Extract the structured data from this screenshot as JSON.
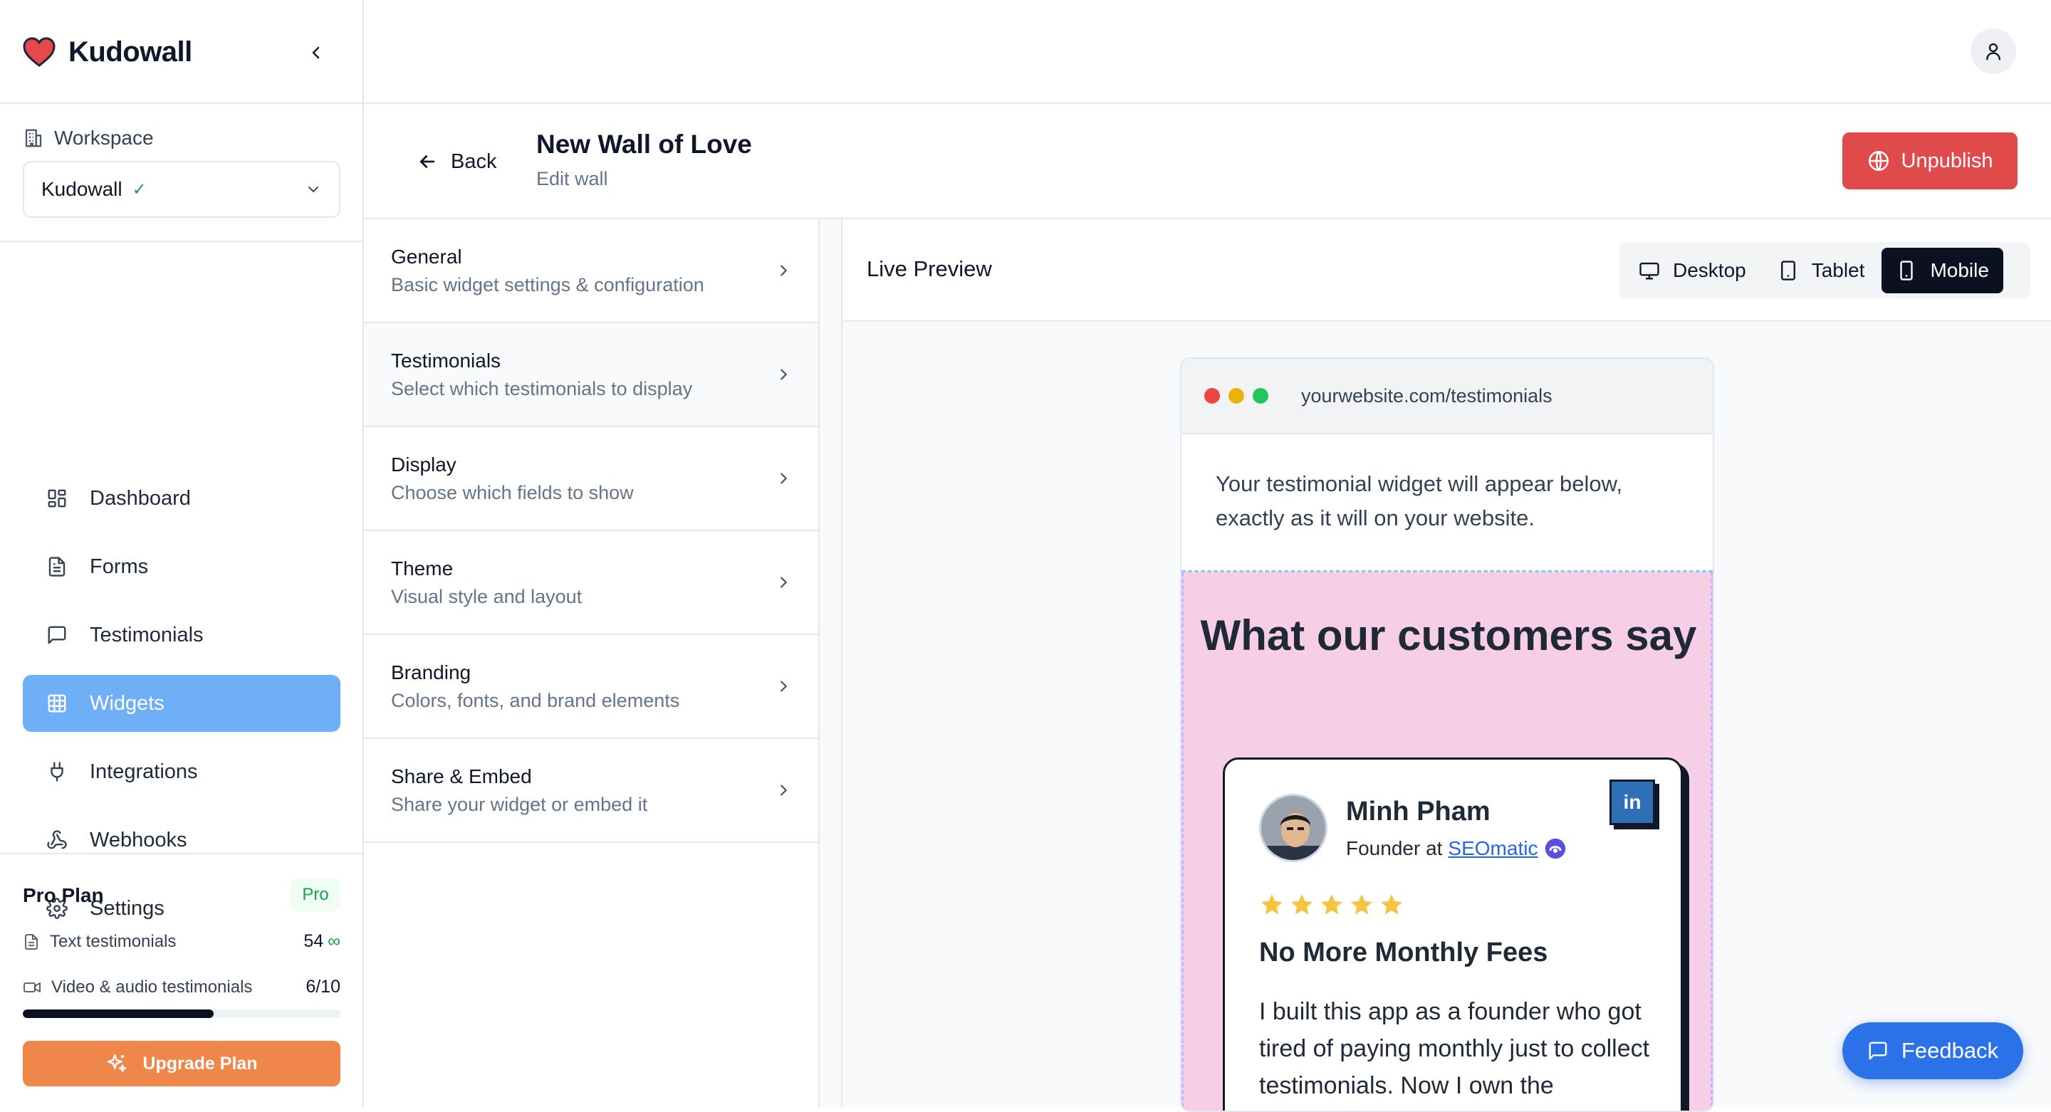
{
  "app": {
    "name": "Kudowall"
  },
  "workspace": {
    "label": "Workspace",
    "selected": "Kudowall",
    "verified_mark": "✓"
  },
  "nav": {
    "items": [
      {
        "label": "Dashboard",
        "icon": "layout-grid-icon"
      },
      {
        "label": "Forms",
        "icon": "file-text-icon"
      },
      {
        "label": "Testimonials",
        "icon": "message-square-icon"
      },
      {
        "label": "Widgets",
        "icon": "grid-table-icon",
        "active": true
      },
      {
        "label": "Integrations",
        "icon": "plug-icon"
      },
      {
        "label": "Webhooks",
        "icon": "webhook-icon"
      },
      {
        "label": "Settings",
        "icon": "gear-icon"
      }
    ]
  },
  "plan": {
    "title": "Pro Plan",
    "badge": "Pro",
    "text_label": "Text testimonials",
    "text_value": "54",
    "text_infinity": "∞",
    "video_label": "Video & audio testimonials",
    "video_value": "6/10",
    "video_progress": 0.6,
    "upgrade_label": "Upgrade Plan"
  },
  "header": {
    "back_label": "Back",
    "title": "New Wall of Love",
    "subtitle": "Edit wall",
    "unpublish_label": "Unpublish"
  },
  "settings": {
    "items": [
      {
        "title": "General",
        "desc": "Basic widget settings & configuration"
      },
      {
        "title": "Testimonials",
        "desc": "Select which testimonials to display"
      },
      {
        "title": "Display",
        "desc": "Choose which fields to show"
      },
      {
        "title": "Theme",
        "desc": "Visual style and layout"
      },
      {
        "title": "Branding",
        "desc": "Colors, fonts, and brand elements"
      },
      {
        "title": "Share & Embed",
        "desc": "Share your widget or embed it"
      }
    ]
  },
  "preview": {
    "title": "Live Preview",
    "devices": [
      "Desktop",
      "Tablet",
      "Mobile"
    ],
    "active_device": "Mobile",
    "url": "yourwebsite.com/testimonials",
    "note": "Your testimonial widget will appear below, exactly as it will on your website.",
    "widget_title": "What our customers say",
    "widget_bg": "#f6cfe6",
    "card": {
      "name": "Minh Pham",
      "role_prefix": "Founder at",
      "company": "SEOmatic",
      "social_badge": "in",
      "rating": 5,
      "headline": "No More Monthly Fees",
      "body": "I built this app as a founder who got tired of paying monthly just to collect testimonials. Now I own the"
    }
  },
  "feedback": {
    "label": "Feedback"
  },
  "colors": {
    "accent_blue": "#6eaff7",
    "danger": "#e14a4a",
    "upgrade": "#f0874a",
    "feedback": "#2b72e8",
    "dark": "#0b1120",
    "star": "#f5c542"
  }
}
